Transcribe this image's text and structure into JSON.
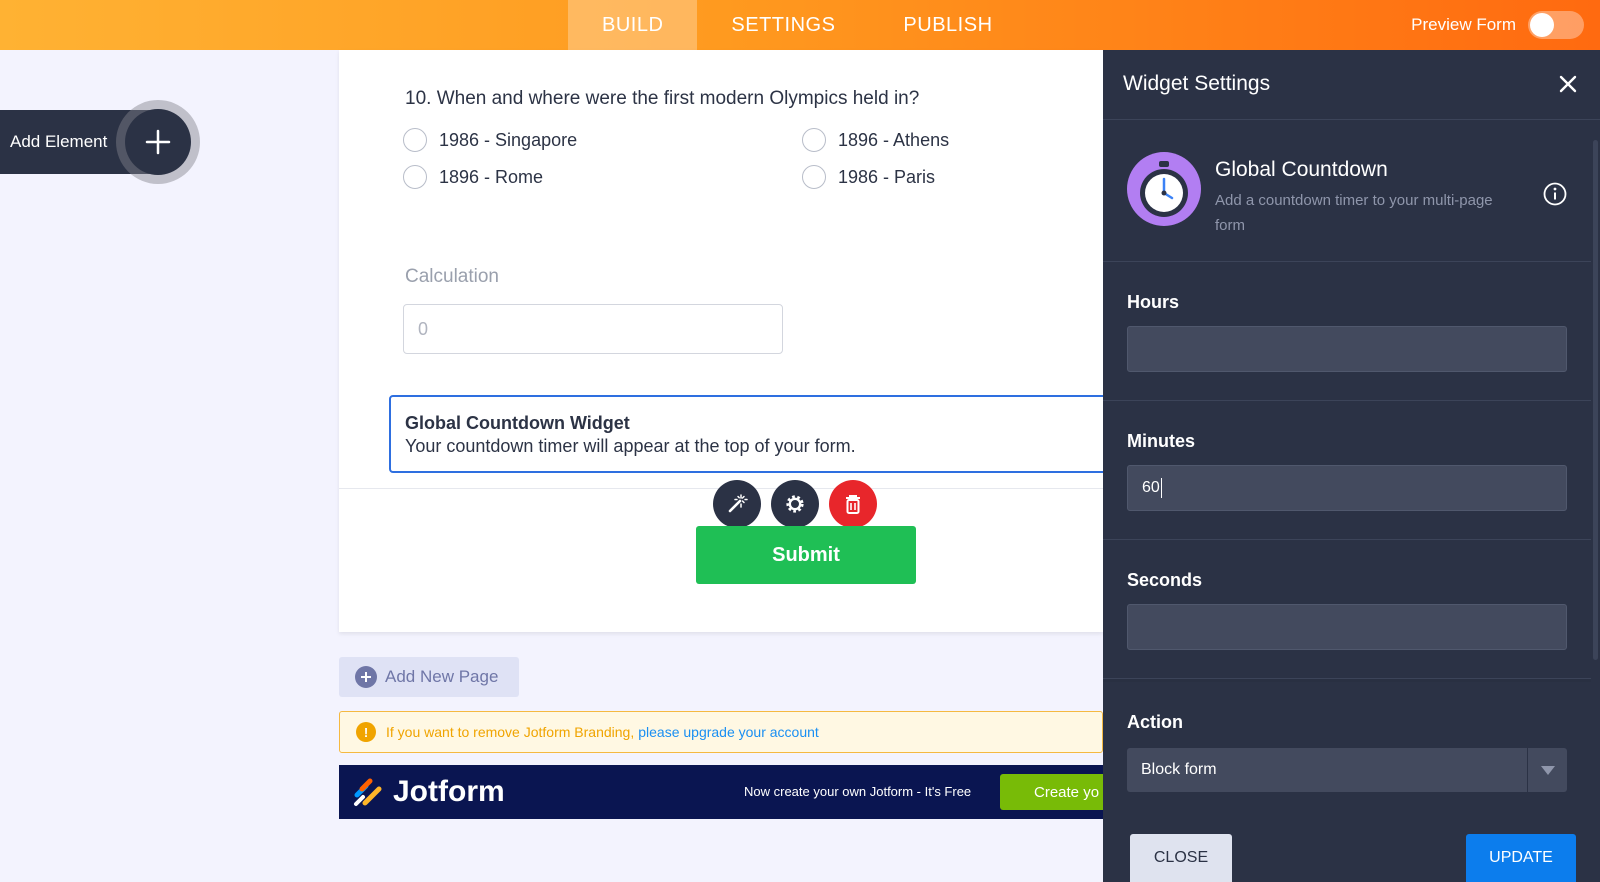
{
  "topbar": {
    "tabs": [
      {
        "label": "BUILD",
        "active": true
      },
      {
        "label": "SETTINGS",
        "active": false
      },
      {
        "label": "PUBLISH",
        "active": false
      }
    ],
    "preview_label": "Preview Form",
    "preview_on": false
  },
  "add_element": {
    "label": "Add Element"
  },
  "form": {
    "question": "10. When and where were the first modern Olympics held in?",
    "options": [
      "1986 - Singapore",
      "1896 - Athens",
      "1896 - Rome",
      "1986 - Paris"
    ],
    "calculation_label": "Calculation",
    "calculation_value": "0",
    "widget_title": "Global Countdown Widget",
    "widget_desc": "Your countdown timer will appear at the top of your form.",
    "submit_label": "Submit"
  },
  "add_page": {
    "label": "Add New Page"
  },
  "branding": {
    "text": "If you want to remove Jotform Branding,",
    "link": "please upgrade your account"
  },
  "footer": {
    "logo": "Jotform",
    "promo": "Now create your own Jotform - It's Free",
    "cta": "Create yo"
  },
  "panel": {
    "title": "Widget Settings",
    "widget_name": "Global Countdown",
    "widget_desc": "Add a countdown timer to your multi-page form",
    "fields": [
      {
        "label": "Hours",
        "value": ""
      },
      {
        "label": "Minutes",
        "value": "60"
      },
      {
        "label": "Seconds",
        "value": ""
      }
    ],
    "action_label": "Action",
    "action_value": "Block form",
    "close_label": "CLOSE",
    "update_label": "UPDATE"
  },
  "colors": {
    "accent_orange": "#ff8a1f",
    "panel_bg": "#2b3245",
    "submit_green": "#1fbf55",
    "update_blue": "#0c7ded",
    "delete_red": "#e8262b"
  }
}
